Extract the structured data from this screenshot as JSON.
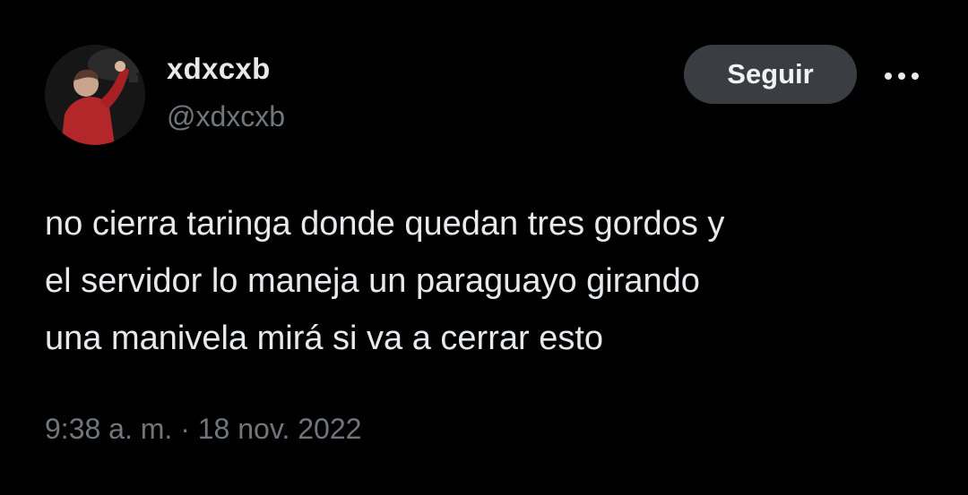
{
  "author": {
    "display_name": "xdxcxb",
    "handle": "@xdxcxb",
    "avatar_icon": "profile-photo-performer-red-shirt"
  },
  "actions": {
    "follow_label": "Seguir",
    "more_icon": "more-horizontal-icon"
  },
  "tweet": {
    "lines": [
      "no cierra taringa donde quedan tres gordos y",
      "el servidor lo maneja un paraguayo girando",
      "una manivela mirá si va a cerrar esto"
    ],
    "time": "9:38 a. m.",
    "separator": "·",
    "date": "18 nov. 2022"
  },
  "colors": {
    "background": "#000000",
    "text_primary": "#e7e9ea",
    "text_secondary": "#71767b",
    "follow_button_bg": "#3a3d41"
  }
}
